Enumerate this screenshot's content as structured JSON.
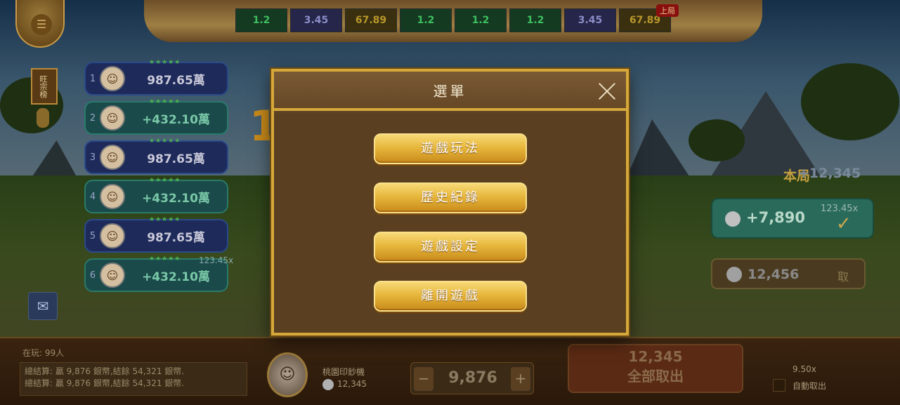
{
  "top_bar": {
    "history": [
      {
        "value": "1.2",
        "tone": "green"
      },
      {
        "value": "3.45",
        "tone": "purple"
      },
      {
        "value": "67.89",
        "tone": "gold"
      },
      {
        "value": "1.2",
        "tone": "green"
      },
      {
        "value": "1.2",
        "tone": "green"
      },
      {
        "value": "1.2",
        "tone": "green"
      },
      {
        "value": "3.45",
        "tone": "purple"
      },
      {
        "value": "67.89",
        "tone": "gold"
      }
    ],
    "last_round_tag": "上局",
    "menu_icon": "hamburger-icon"
  },
  "leaderboard": {
    "title": "旺宗榜",
    "rows": [
      {
        "rank": "1",
        "value": "987.65萬",
        "stars": "★★★★★"
      },
      {
        "rank": "2",
        "value": "+432.10萬",
        "stars": "★★★★★"
      },
      {
        "rank": "3",
        "value": "987.65萬",
        "stars": "★★★★★"
      },
      {
        "rank": "4",
        "value": "+432.10萬",
        "stars": "★★★★★"
      },
      {
        "rank": "5",
        "value": "987.65萬",
        "stars": "★★★★★"
      },
      {
        "rank": "6",
        "value": "+432.10萬",
        "stars": "★★★★★"
      }
    ],
    "multiplier_tag": "123.45x",
    "mail_icon": "mail-icon"
  },
  "game_area": {
    "big_digit": "1",
    "round_label": "本局",
    "round_value": "+12,345",
    "bet_amount": "+7,890",
    "bet_multiplier": "123.45x",
    "cash_amount": "12,456",
    "cash_take_label": "取"
  },
  "bottom_bar": {
    "online_label": "在玩: 99人",
    "settle_lines": [
      "總結算: 贏 9,876 銀幣,結餘 54,321 銀幣.",
      "總結算: 贏 9,876 銀幣,結餘 54,321 銀幣."
    ],
    "player_name": "桃園印鈔機",
    "player_balance": "12,345",
    "bet_value": "9,876",
    "stepper_minus": "−",
    "stepper_plus": "+",
    "cashout_amount": "12,345",
    "cashout_label": "全部取出",
    "auto_multiplier": "9.50x",
    "auto_label": "自動取出"
  },
  "modal": {
    "title": "選單",
    "close_icon": "close-icon",
    "options": [
      "遊戲玩法",
      "歷史紀錄",
      "遊戲設定",
      "離開遊戲"
    ],
    "accent": "#d6a83a"
  }
}
